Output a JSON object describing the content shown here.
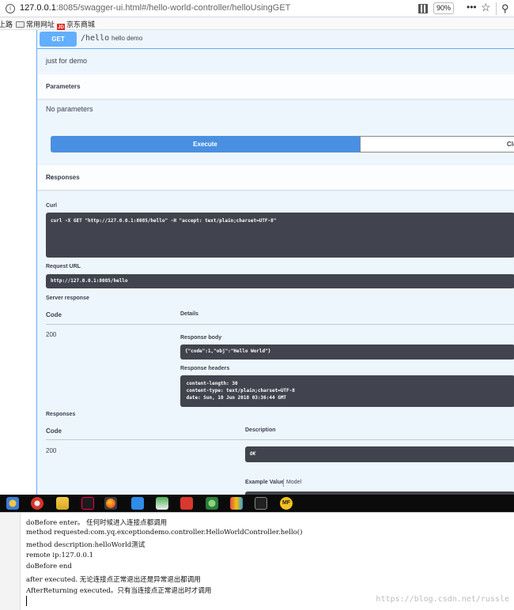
{
  "browser": {
    "url_host": "127.0.0.1",
    "url_rest": ":8085/swagger-ui.html#/hello-world-controller/helloUsingGET",
    "zoom": "90%",
    "more": "•••",
    "bookmarks": [
      {
        "label": "上路"
      },
      {
        "label": "常用网址"
      },
      {
        "label": "京东商城",
        "badge": "JD"
      }
    ]
  },
  "endpoint": {
    "method": "GET",
    "path": "/hello",
    "summary": "hello demo",
    "description": "just for demo"
  },
  "parameters": {
    "title": "Parameters",
    "empty": "No parameters"
  },
  "actions": {
    "execute": "Execute",
    "clear": "Clear"
  },
  "responses_header": {
    "title": "Responses",
    "right": "Re"
  },
  "live": {
    "curl_label": "Curl",
    "curl": "curl -X GET \"http://127.0.0.1:8085/hello\" -H \"accept: text/plain;charset=UTF-8\"",
    "request_url_label": "Request URL",
    "request_url": "http://127.0.0.1:8085/hello",
    "server_response_label": "Server response",
    "col_code": "Code",
    "col_details": "Details",
    "code": "200",
    "body_label": "Response body",
    "body": "{\"code\":1,\"obj\":\"Hello World\"}",
    "headers_label": "Response headers",
    "headers": " content-length: 30\n content-type: text/plain;charset=UTF-8\n date: Sun, 10 Jun 2018 03:36:44 GMT"
  },
  "documented": {
    "title": "Responses",
    "col_code": "Code",
    "col_description": "Description",
    "code": "200",
    "description": "OK",
    "example_value": "Example Value",
    "model": "Model"
  },
  "console": {
    "lines": [
      "doBefore enter。 任何时候进入连接点都调用",
      "method requested:com.yq.exceptiondemo.controller.HelloWorldController.hello()",
      "method description:helloWorld测试",
      "remote ip:127.0.0.1",
      "doBefore end",
      "after  executed. 无论连接点正常退出还是异常退出都调用",
      "AfterReturning executed。只有当连接点正常退出时才调用"
    ],
    "watermark": "https://blog.csdn.net/russle"
  },
  "colors": {
    "get_accent": "#61affe",
    "execute_blue": "#4990e2",
    "code_bg": "#41444e",
    "taskbar": "#0b0b0b"
  },
  "taskbar_icons": [
    "media-player-icon",
    "bird-app-icon",
    "folder-icon",
    "intellij-icon",
    "firefox-icon",
    "sticky-note-icon",
    "editor-icon",
    "notepad-icon",
    "redis-icon",
    "teamspeak-icon",
    "color-picker-icon",
    "terminal-icon",
    "mf-app-icon"
  ]
}
